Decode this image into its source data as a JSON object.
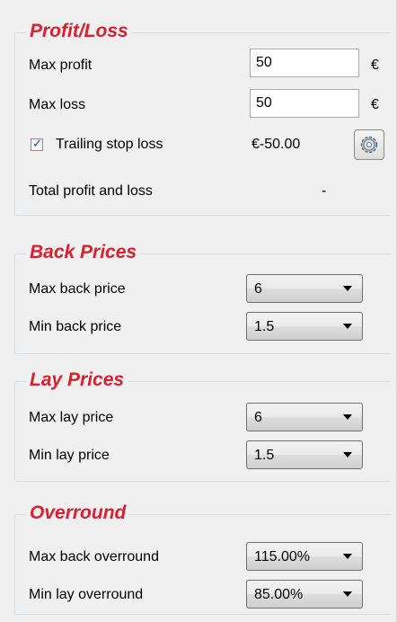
{
  "profit_loss": {
    "title": "Profit/Loss",
    "max_profit_label": "Max profit",
    "max_profit_value": "50",
    "max_loss_label": "Max loss",
    "max_loss_value": "50",
    "currency": "€",
    "trailing_stop_label": "Trailing stop loss",
    "trailing_stop_checked": true,
    "trailing_stop_value": "€-50.00",
    "settings_icon": "gear-icon",
    "total_label": "Total profit and loss",
    "total_value": "-"
  },
  "back_prices": {
    "title": "Back Prices",
    "max_label": "Max back price",
    "max_value": "6",
    "min_label": "Min back price",
    "min_value": "1.5"
  },
  "lay_prices": {
    "title": "Lay Prices",
    "max_label": "Max lay price",
    "max_value": "6",
    "min_label": "Min lay price",
    "min_value": "1.5"
  },
  "overround": {
    "title": "Overround",
    "max_back_label": "Max back overround",
    "max_back_value": "115.00%",
    "min_lay_label": "Min lay overround",
    "min_lay_value": "85.00%"
  },
  "colors": {
    "section_title": "#d8202f",
    "panel_bg": "#f0f0f0"
  }
}
